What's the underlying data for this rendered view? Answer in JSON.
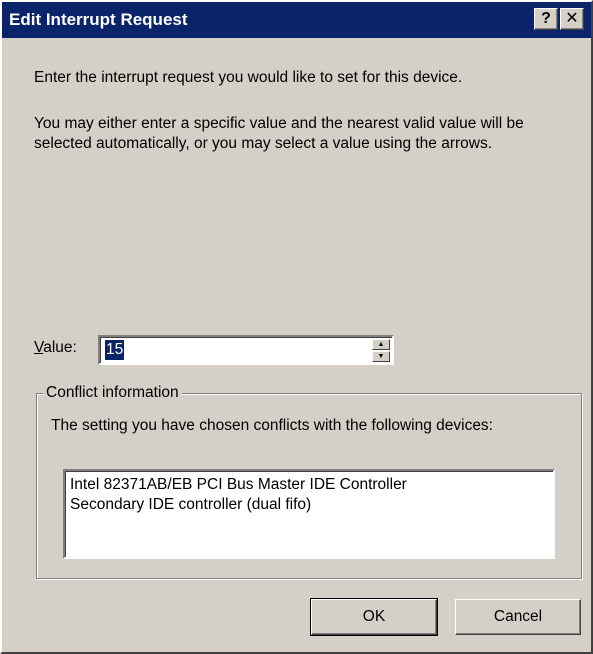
{
  "window": {
    "title": "Edit Interrupt Request",
    "help_label": "?",
    "close_label": "✕"
  },
  "instructions": {
    "line1": "Enter the interrupt request you would like to set for this device.",
    "line2": "You may either enter a specific value and the nearest valid value will be selected automatically, or you may select a value using the arrows."
  },
  "value_field": {
    "label_mnemonic": "V",
    "label_rest": "alue:",
    "value": "15",
    "spin_up_icon": "▲",
    "spin_down_icon": "▼"
  },
  "conflict": {
    "group_label": "Conflict information",
    "description": "The setting you have chosen conflicts with the following devices:",
    "devices": [
      "Intel 82371AB/EB PCI Bus Master IDE Controller",
      "Secondary IDE controller (dual fifo)"
    ]
  },
  "buttons": {
    "ok": "OK",
    "cancel": "Cancel"
  },
  "colors": {
    "titlebar": "#0a246a",
    "face": "#d4d0c8",
    "selection": "#0a246a"
  }
}
